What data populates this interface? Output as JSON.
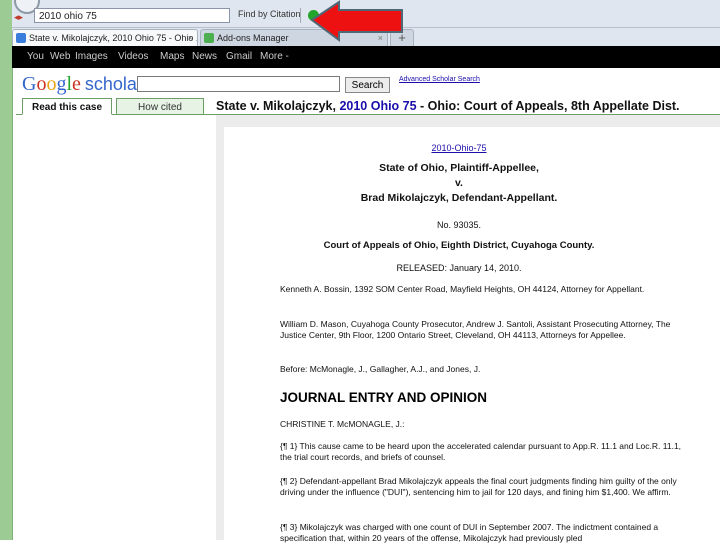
{
  "browser": {
    "url": "2010 ohio 75",
    "find_citation": "Find by Citation",
    "tabs": [
      {
        "label": "State v. Mikolajczyk, 2010 Ohio 75 - Ohio ...",
        "close": "×"
      },
      {
        "label": "Add-ons Manager",
        "close": "×"
      }
    ],
    "new_tab": "+"
  },
  "google_bar": [
    "You",
    "Web",
    "Images",
    "Videos",
    "Maps",
    "News",
    "Gmail",
    "More -"
  ],
  "scholar": {
    "logo_google": [
      "G",
      "o",
      "o",
      "g",
      "l",
      "e"
    ],
    "logo_scholar": "scholar",
    "search_button": "Search",
    "advanced_link": "Advanced Scholar Search",
    "tab_read": "Read this case",
    "tab_cited": "How cited",
    "title_pre": "State v. Mikolajczyk, ",
    "title_link": "2010 Ohio 75",
    "title_post": " - Ohio: Court of Appeals, 8th Appellate Dist."
  },
  "document": {
    "citation": "2010-Ohio-75",
    "party1": "State of Ohio, Plaintiff-Appellee,",
    "v": "v.",
    "party2": "Brad Mikolajczyk, Defendant-Appellant.",
    "number": "No. 93035.",
    "court": "Court of Appeals of Ohio, Eighth District, Cuyahoga County.",
    "released": "RELEASED: January 14, 2010.",
    "attorney1": "Kenneth A. Bossin, 1392 SOM Center Road, Mayfield Heights, OH 44124, Attorney for Appellant.",
    "attorney2": "William D. Mason, Cuyahoga County Prosecutor, Andrew J. Santoli, Assistant Prosecuting Attorney, The Justice Center, 9th Floor, 1200 Ontario Street, Cleveland, OH 44113, Attorneys for Appellee.",
    "before": "Before: McMonagle, J., Gallagher, A.J., and Jones, J.",
    "heading": "JOURNAL ENTRY AND OPINION",
    "author": "CHRISTINE T. McMONAGLE, J.:",
    "p1": "{¶ 1} This cause came to be heard upon the accelerated calendar pursuant to App.R. 11.1 and Loc.R. 11.1, the trial court records, and briefs of counsel.",
    "p2": "{¶ 2} Defendant-appellant Brad Mikolajczyk appeals the final court judgments finding him guilty of the only driving under the influence (\"DUI\"), sentencing him to jail for 120 days, and fining him $1,400. We affirm.",
    "p3": "{¶ 3} Mikolajczyk was charged with one count of DUI in September 2007. The indictment contained a specification that, within 20 years of the offense, Mikolajczyk had previously pled"
  }
}
